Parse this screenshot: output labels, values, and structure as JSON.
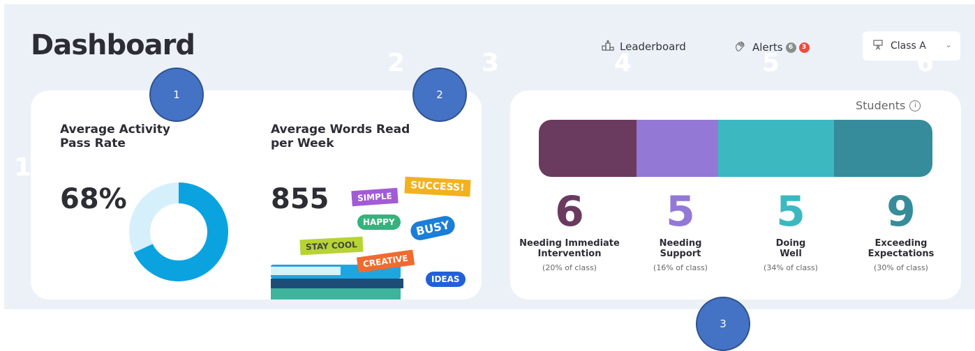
{
  "page": {
    "title": "Dashboard"
  },
  "ghost_numbers": [
    "1",
    "2",
    "3",
    "4",
    "5",
    "6"
  ],
  "nav": {
    "leaderboard_label": "Leaderboard",
    "alerts_label": "Alerts",
    "alerts_badge_grey": "6",
    "alerts_badge_red": "3",
    "class_select": "Class A"
  },
  "metrics": {
    "pass_rate_title_line1": "Average Activity",
    "pass_rate_title_line2": "Pass Rate",
    "pass_rate_value": "68%",
    "pass_rate_fraction": 0.68,
    "words_title_line1": "Average Words Read",
    "words_title_line2": "per Week",
    "words_value": "855"
  },
  "stickers": [
    "SIMPLE",
    "SUCCESS!",
    "HAPPY",
    "BUSY",
    "STAY COOL",
    "CREATIVE",
    "IDEAS"
  ],
  "students": {
    "label": "Students",
    "info_icon": "i",
    "groups": [
      {
        "count": "6",
        "line1": "Needing Immediate",
        "line2": "Intervention",
        "pct": "(20% of class)",
        "color": "#6b3a5f"
      },
      {
        "count": "5",
        "line1": "Needing",
        "line2": "Support",
        "pct": "(16% of class)",
        "color": "#9478d6"
      },
      {
        "count": "5",
        "line1": "Doing",
        "line2": "Well",
        "pct": "(34% of class)",
        "color": "#3cb8c1"
      },
      {
        "count": "9",
        "line1": "Exceeding",
        "line2": "Expectations",
        "pct": "(30% of class)",
        "color": "#368c9b"
      }
    ]
  },
  "callouts": [
    "1",
    "2",
    "3"
  ],
  "colors": {
    "donut": "#0aa3e0",
    "donut_track": "#d6f0fb",
    "background": "#ecf1f7"
  }
}
